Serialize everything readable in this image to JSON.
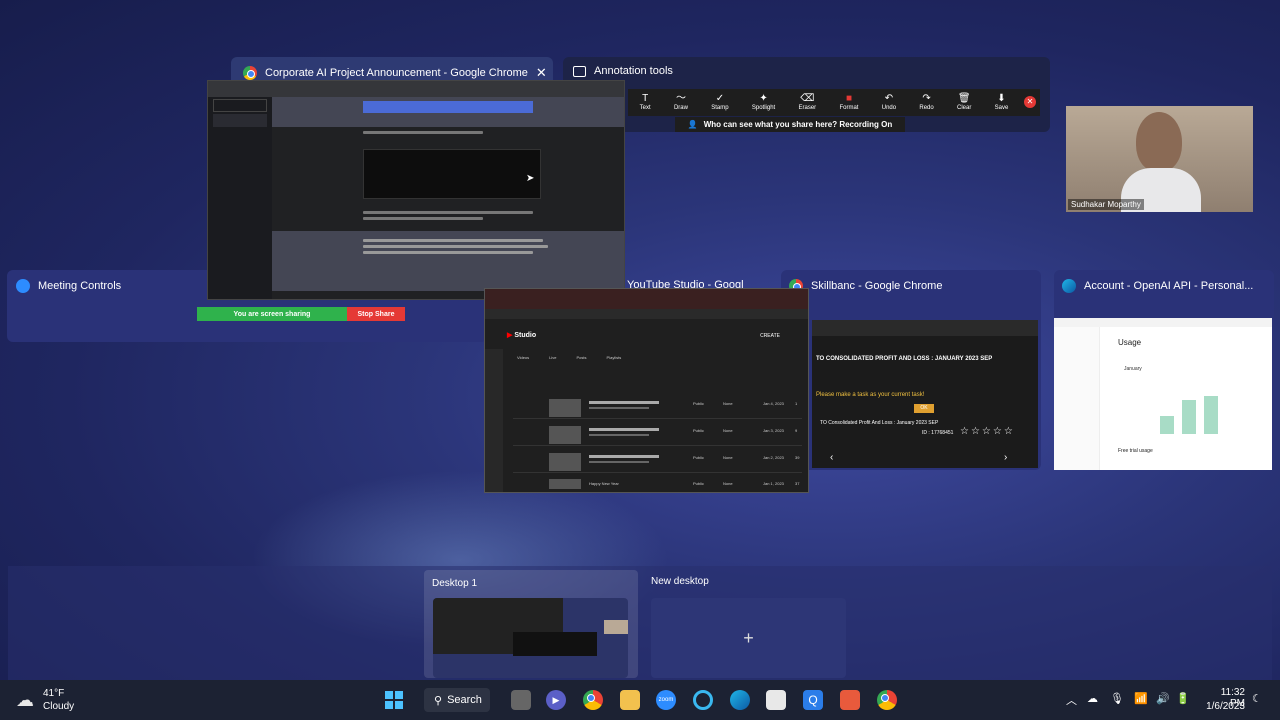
{
  "windows": {
    "chrome_main": {
      "title": "Corporate AI Project Announcement - Google Chrome",
      "close": "✕"
    },
    "annotation": {
      "title": "Annotation tools",
      "tools": [
        "Text",
        "Draw",
        "Stamp",
        "Spotlight",
        "Eraser",
        "Format",
        "Undo",
        "Redo",
        "Clear",
        "Save"
      ],
      "tool_glyphs": [
        "T",
        "〜",
        "✓",
        "✦",
        "⌫",
        "■",
        "↶",
        "↷",
        "🗑",
        "⬇"
      ],
      "share_notice": "Who can see what you share here? Recording On"
    },
    "meeting_controls": {
      "title": "Meeting Controls"
    },
    "youtube": {
      "title": "YouTube Studio - Googl",
      "brand": "Studio",
      "create": "CREATE",
      "tabs": [
        "Videos",
        "Live",
        "Posts",
        "Playlists"
      ],
      "rows": [
        {
          "title": "CrowdSourced AI project requireme...",
          "vis": "Public",
          "restr": "None",
          "date": "Jan 4, 2023",
          "views": "1"
        },
        {
          "title": "Build a task app using the GPT-3...",
          "vis": "Public",
          "restr": "None",
          "date": "Jan 3, 2023",
          "views": "9"
        },
        {
          "title": "CrowdSourced AI project parser cont...",
          "vis": "Public",
          "restr": "None",
          "date": "Jan 2, 2023",
          "views": "39"
        },
        {
          "title": "Happy New Year",
          "vis": "Public",
          "restr": "None",
          "date": "Jan 1, 2023",
          "views": "37"
        }
      ]
    },
    "skillbanc": {
      "title": "Skillbanc - Google Chrome",
      "heading": "TO CONSOLIDATED PROFIT AND LOSS : JANUARY 2023 SEP",
      "prompt": "Please make a task as your current task!",
      "ok": "OK",
      "footer": "TO Consolidated Profit And Loss : January 2023 SEP",
      "id": "ID : 17768451"
    },
    "openai": {
      "title": "Account - OpenAI API - Personal...",
      "usage": "Usage",
      "month": "January",
      "free": "Free trial usage"
    }
  },
  "screen_share": {
    "status": "You are screen sharing",
    "stop": "Stop Share"
  },
  "video": {
    "name": "Sudhakar Moparthy"
  },
  "desktops": [
    {
      "label": "Desktop 1"
    },
    {
      "label": "New desktop",
      "plus": "+"
    }
  ],
  "taskbar": {
    "weather": {
      "temp": "41°F",
      "cond": "Cloudy"
    },
    "search": "Search",
    "time": "11:32 PM",
    "date": "1/6/2023"
  }
}
